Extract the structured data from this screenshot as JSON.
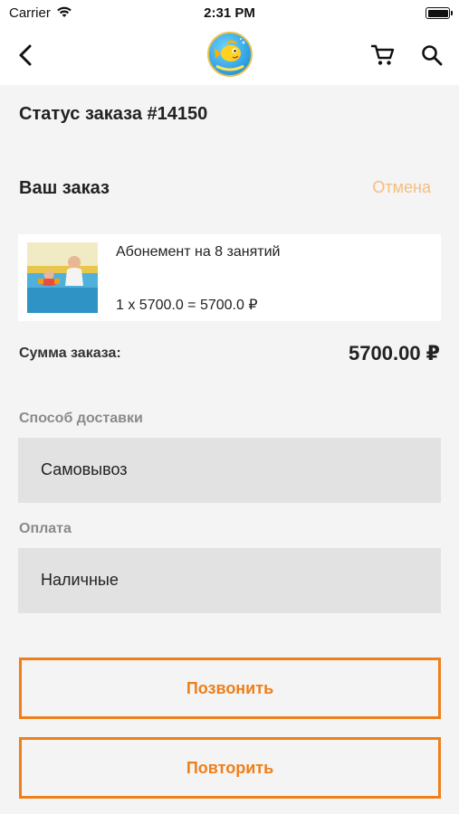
{
  "status_bar": {
    "carrier": "Carrier",
    "time": "2:31 PM",
    "icons": [
      "wifi-icon",
      "battery-icon"
    ]
  },
  "nav": {
    "icons": [
      "back-chevron-icon",
      "brand-logo",
      "cart-icon",
      "search-icon"
    ]
  },
  "order": {
    "title": "Статус заказа #14150",
    "section_title": "Ваш заказ",
    "cancel_label": "Отмена",
    "items": [
      {
        "name": "Абонемент на 8 занятий",
        "calc": "1 x 5700.0 = 5700.0 ₽"
      }
    ],
    "sum_label": "Сумма заказа:",
    "sum_value": "5700.00 ₽"
  },
  "delivery": {
    "label": "Способ доставки",
    "value": "Самовывоз"
  },
  "payment": {
    "label": "Оплата",
    "value": "Наличные"
  },
  "actions": {
    "call_label": "Позвонить",
    "repeat_label": "Повторить"
  },
  "colors": {
    "accent": "#ef7f1a",
    "cancel": "#f6bd7d",
    "field_bg": "#e2e2e2",
    "page_bg": "#f4f4f4"
  }
}
